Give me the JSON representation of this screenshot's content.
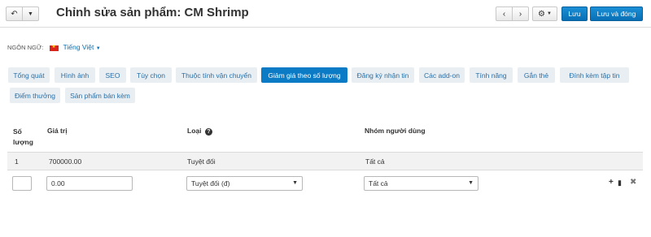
{
  "header": {
    "title": "Chỉnh sửa sản phẩm: CM Shrimp",
    "back_icon": "back-arrow-icon",
    "dropdown_icon": "caret-down-icon",
    "prev_icon": "chevron-left-icon",
    "next_icon": "chevron-right-icon",
    "settings_icon": "gear-icon",
    "save_label": "Lưu",
    "save_close_label": "Lưu và đóng"
  },
  "language": {
    "label": "NGÔN NGỮ:",
    "value": "Tiếng Việt",
    "flag_icon": "vietnam-flag-icon"
  },
  "tabs": [
    {
      "label": "Tổng quát"
    },
    {
      "label": "Hình ảnh"
    },
    {
      "label": "SEO"
    },
    {
      "label": "Tùy chọn"
    },
    {
      "label": "Thuộc tính vận chuyển"
    },
    {
      "label": "Giảm giá theo số lượng",
      "active": true
    },
    {
      "label": "Đăng ký nhận tin"
    },
    {
      "label": "Các add-on"
    },
    {
      "label": "Tính năng"
    },
    {
      "label": "Gắn thẻ"
    },
    {
      "label": "Đính kèm tập tin"
    },
    {
      "label": "Điểm thưởng"
    },
    {
      "label": "Sản phẩm bán kèm"
    }
  ],
  "table": {
    "headers": {
      "quantity_line1": "Số",
      "quantity_line2": "lượng",
      "value": "Giá trị",
      "type": "Loại",
      "user_group": "Nhóm người dùng"
    },
    "existing_row": {
      "quantity": "1",
      "value": "700000.00",
      "type": "Tuyệt đối",
      "user_group": "Tất cả"
    },
    "new_row": {
      "quantity": "",
      "value": "0.00",
      "type": "Tuyệt đối (đ)",
      "user_group": "Tất cả"
    }
  },
  "colors": {
    "accent": "#0b7bc6",
    "tab_bg": "#e9eef2"
  }
}
